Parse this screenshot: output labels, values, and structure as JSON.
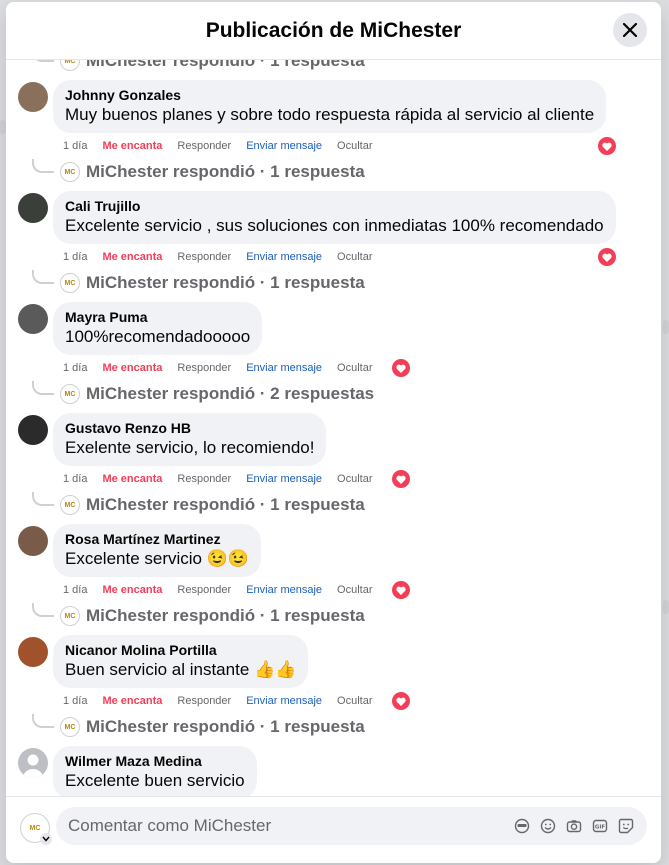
{
  "modal": {
    "title": "Publicación de MiChester",
    "close_label": "×"
  },
  "top_reply": {
    "text": "MiChester respondió · 1 respuesta"
  },
  "comments": [
    {
      "author": "Johnny Gonzales",
      "text": "Muy buenos planes y sobre todo respuesta rápida al servicio al cliente",
      "time": "1 día",
      "like": "Me encanta",
      "reply": "Responder",
      "message": "Enviar mensaje",
      "hide": "Ocultar",
      "replies": "MiChester respondió · 1 respuesta",
      "avatar_color": "#8a6f5a"
    },
    {
      "author": "Cali Trujillo",
      "text": "Excelente servicio , sus soluciones con inmediatas 100% recomendado",
      "time": "1 día",
      "like": "Me encanta",
      "reply": "Responder",
      "message": "Enviar mensaje",
      "hide": "Ocultar",
      "replies": "MiChester respondió · 1 respuesta",
      "avatar_color": "#3a3f3a"
    },
    {
      "author": "Mayra Puma",
      "text": "100%recomendadooooo",
      "time": "1 día",
      "like": "Me encanta",
      "reply": "Responder",
      "message": "Enviar mensaje",
      "hide": "Ocultar",
      "replies": "MiChester respondió · 2 respuestas",
      "avatar_color": "#5a5a5a"
    },
    {
      "author": "Gustavo Renzo HB",
      "text": "Exelente servicio, lo recomiendo!",
      "time": "1 día",
      "like": "Me encanta",
      "reply": "Responder",
      "message": "Enviar mensaje",
      "hide": "Ocultar",
      "replies": "MiChester respondió · 1 respuesta",
      "avatar_color": "#2b2b2b"
    },
    {
      "author": "Rosa Martínez Martinez",
      "text": "Excelente servicio 😉😉",
      "time": "1 día",
      "like": "Me encanta",
      "reply": "Responder",
      "message": "Enviar mensaje",
      "hide": "Ocultar",
      "replies": "MiChester respondió · 1 respuesta",
      "avatar_color": "#7a5b4a"
    },
    {
      "author": "Nicanor Molina Portilla",
      "text": "Buen servicio al instante 👍👍",
      "time": "1 día",
      "like": "Me encanta",
      "reply": "Responder",
      "message": "Enviar mensaje",
      "hide": "Ocultar",
      "replies": "MiChester respondió · 1 respuesta",
      "avatar_color": "#a0522d"
    },
    {
      "author": "Wilmer Maza Medina",
      "text": "Excelente buen servicio",
      "avatar_color": "#bcc0c4"
    }
  ],
  "footer": {
    "placeholder": "Comentar como MiChester",
    "avatar_label": "MiChester"
  },
  "colors": {
    "love": "#f33e58",
    "message_link": "#1b5fbb",
    "bubble": "#f0f2f5"
  }
}
